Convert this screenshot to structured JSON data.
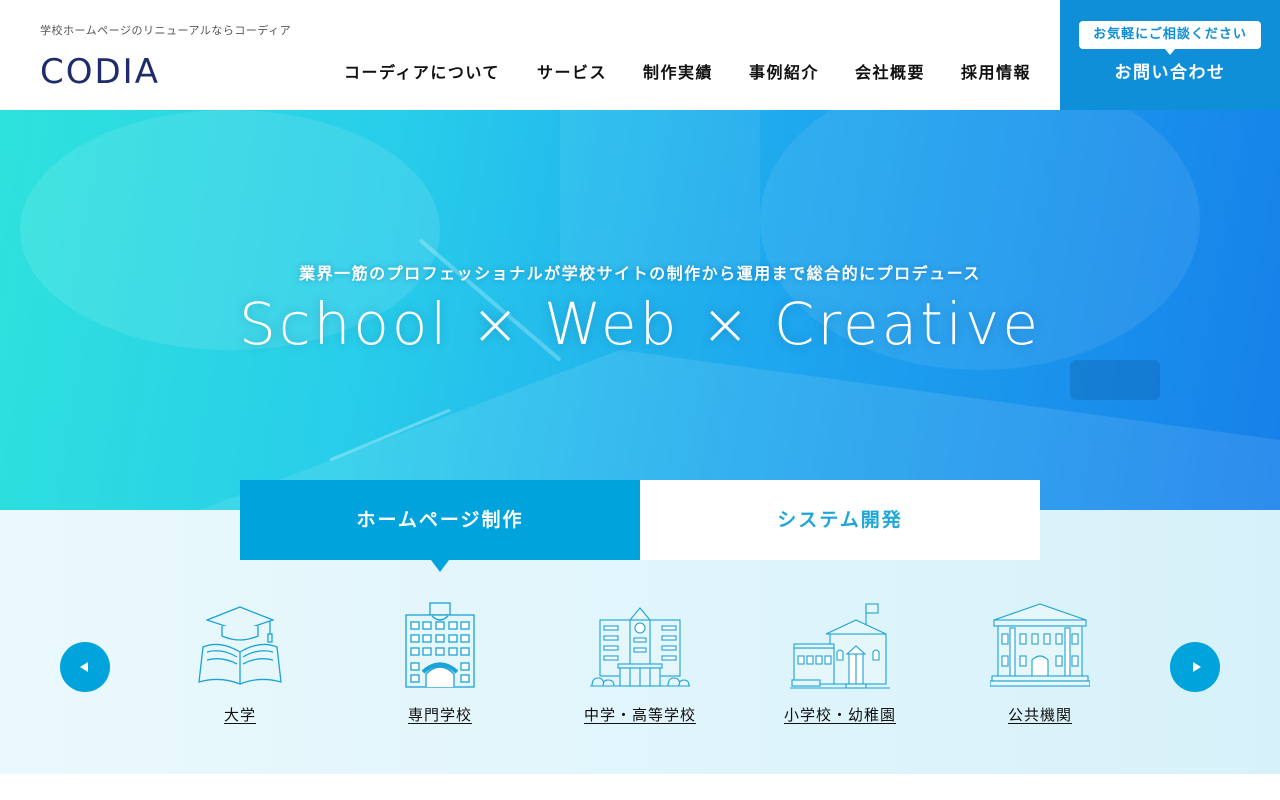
{
  "header": {
    "tagline": "学校ホームページのリニューアルならコーディア",
    "logo_text": "CODIA",
    "nav": [
      {
        "label": "コーディアについて"
      },
      {
        "label": "サービス"
      },
      {
        "label": "制作実績"
      },
      {
        "label": "事例紹介"
      },
      {
        "label": "会社概要"
      },
      {
        "label": "採用情報"
      }
    ],
    "contact": {
      "bubble": "お気軽にご相談ください",
      "label": "お問い合わせ"
    }
  },
  "hero": {
    "subtitle": "業界一筋のプロフェッショナルが学校サイトの制作から運用まで総合的にプロデュース",
    "title": "School × Web × Creative"
  },
  "tabs": [
    {
      "label": "ホームページ制作",
      "active": true
    },
    {
      "label": "システム開発",
      "active": false
    }
  ],
  "categories": [
    {
      "label": "大学",
      "icon": "university-icon"
    },
    {
      "label": "専門学校",
      "icon": "vocational-school-icon"
    },
    {
      "label": "中学・高等学校",
      "icon": "high-school-icon"
    },
    {
      "label": "小学校・幼稚園",
      "icon": "elementary-school-icon"
    },
    {
      "label": "公共機関",
      "icon": "public-institution-icon"
    }
  ],
  "colors": {
    "brand_navy": "#1e2c6b",
    "accent_blue": "#00a3dc",
    "contact_blue": "#0f8fd8"
  }
}
